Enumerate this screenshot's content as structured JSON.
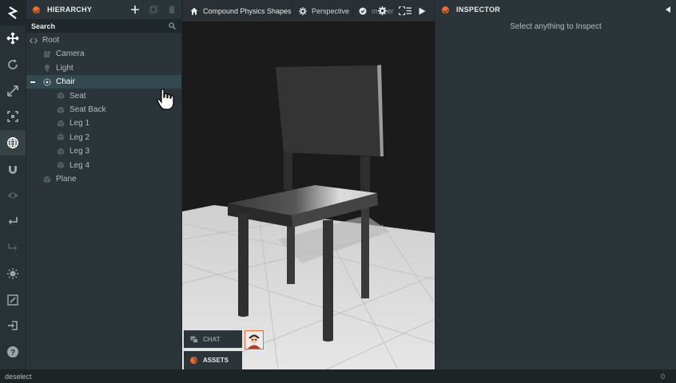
{
  "toolbar": {
    "tools": [
      "logo-icon",
      "move-icon",
      "rotate-icon",
      "scale-icon",
      "resize-icon",
      "world-icon",
      "magnet-icon",
      "eye-icon",
      "undo-icon",
      "redo-icon",
      "light-icon",
      "edit-icon",
      "publish-icon",
      "help-icon"
    ],
    "active_tool": "world-icon"
  },
  "hierarchy": {
    "title": "HIERARCHY",
    "search_label": "Search",
    "items": [
      {
        "label": "Root",
        "depth": 0,
        "icon": "code-icon",
        "selected": false
      },
      {
        "label": "Camera",
        "depth": 1,
        "icon": "camera-icon",
        "selected": false
      },
      {
        "label": "Light",
        "depth": 1,
        "icon": "bulb-icon",
        "selected": false
      },
      {
        "label": "Chair",
        "depth": 1,
        "icon": "entity-icon",
        "selected": true,
        "expanded": true
      },
      {
        "label": "Seat",
        "depth": 2,
        "icon": "cube-icon",
        "selected": false
      },
      {
        "label": "Seat Back",
        "depth": 2,
        "icon": "cube-icon",
        "selected": false
      },
      {
        "label": "Leg 1",
        "depth": 2,
        "icon": "cube-icon",
        "selected": false
      },
      {
        "label": "Leg 2",
        "depth": 2,
        "icon": "cube-icon",
        "selected": false
      },
      {
        "label": "Leg 3",
        "depth": 2,
        "icon": "cube-icon",
        "selected": false
      },
      {
        "label": "Leg 4",
        "depth": 2,
        "icon": "cube-icon",
        "selected": false
      },
      {
        "label": "Plane",
        "depth": 1,
        "icon": "cube-icon",
        "selected": false
      }
    ]
  },
  "viewport": {
    "project_name": "Compound Physics Shapes",
    "camera_label": "Perspective",
    "branch_label": "master"
  },
  "inspector": {
    "title": "INSPECTOR",
    "empty_message": "Select anything to Inspect"
  },
  "bottom": {
    "chat_label": "CHAT",
    "assets_label": "ASSETS",
    "status_text": "deselect",
    "status_count": "0"
  },
  "colors": {
    "accent": "#f16a2b",
    "panel": "#2b3438",
    "selected_row": "#34494f"
  }
}
